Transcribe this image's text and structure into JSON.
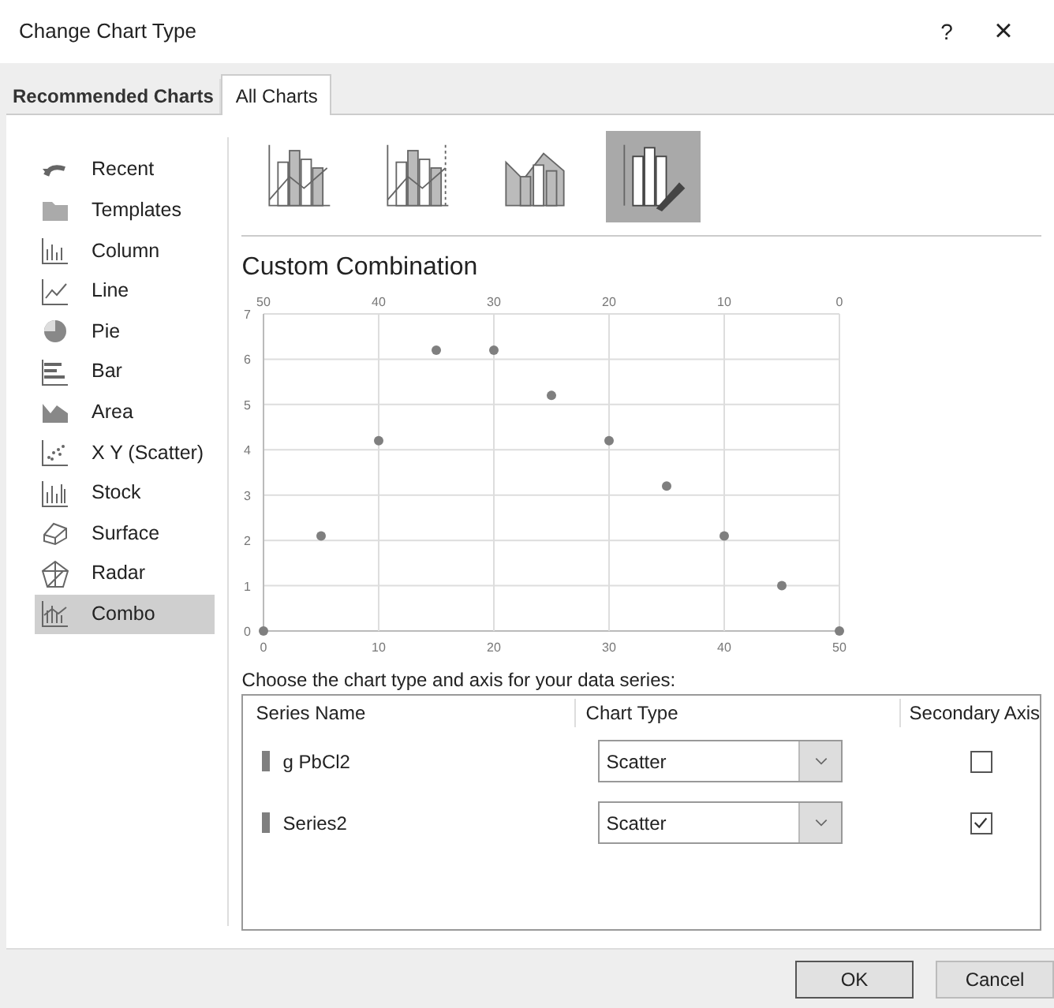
{
  "window": {
    "title": "Change Chart Type",
    "help": "?",
    "close": "×"
  },
  "tabs": [
    {
      "label": "Recommended Charts",
      "selected": false
    },
    {
      "label": "All Charts",
      "selected": true
    }
  ],
  "sidebar": {
    "items": [
      {
        "label": "Recent",
        "selected": false
      },
      {
        "label": "Templates",
        "selected": false
      },
      {
        "label": "Column",
        "selected": false
      },
      {
        "label": "Line",
        "selected": false
      },
      {
        "label": "Pie",
        "selected": false
      },
      {
        "label": "Bar",
        "selected": false
      },
      {
        "label": "Area",
        "selected": false
      },
      {
        "label": "X Y (Scatter)",
        "selected": false
      },
      {
        "label": "Stock",
        "selected": false
      },
      {
        "label": "Surface",
        "selected": false
      },
      {
        "label": "Radar",
        "selected": false
      },
      {
        "label": "Combo",
        "selected": true
      }
    ]
  },
  "gallery": [
    {
      "selected": false
    },
    {
      "selected": false
    },
    {
      "selected": false
    },
    {
      "selected": true
    }
  ],
  "preview": {
    "title": "Custom Combination",
    "top_axis_labels": [
      "50",
      "40",
      "30",
      "20",
      "10",
      "0"
    ],
    "chart_data": {
      "type": "scatter",
      "x": [
        0,
        5,
        10,
        15,
        20,
        25,
        30,
        35,
        40,
        45,
        50
      ],
      "grid": true,
      "series": [
        {
          "color": "#7f7f7f",
          "values": [
            0,
            2.1,
            4.2,
            6.2,
            6.2,
            5.2,
            4.2,
            3.2,
            2.1,
            1.0,
            0
          ]
        }
      ],
      "xlim": [
        0,
        50
      ],
      "ylim": [
        0,
        7
      ],
      "xticks": [
        0,
        10,
        20,
        30,
        40,
        50
      ],
      "yticks": [
        0,
        1,
        2,
        3,
        4,
        5,
        6,
        7
      ]
    }
  },
  "series_table": {
    "caption": "Choose the chart type and axis for your data series:",
    "columns": [
      "Series Name",
      "Chart Type",
      "Secondary Axis"
    ],
    "rows": [
      {
        "name": "g PbCl2",
        "color": "#7f7f7f",
        "chart_type": "Scatter",
        "secondary_axis": false
      },
      {
        "name": "Series2",
        "color": "#7f7f7f",
        "chart_type": "Scatter",
        "secondary_axis": true
      }
    ]
  },
  "buttons": [
    "OK",
    "Cancel"
  ]
}
